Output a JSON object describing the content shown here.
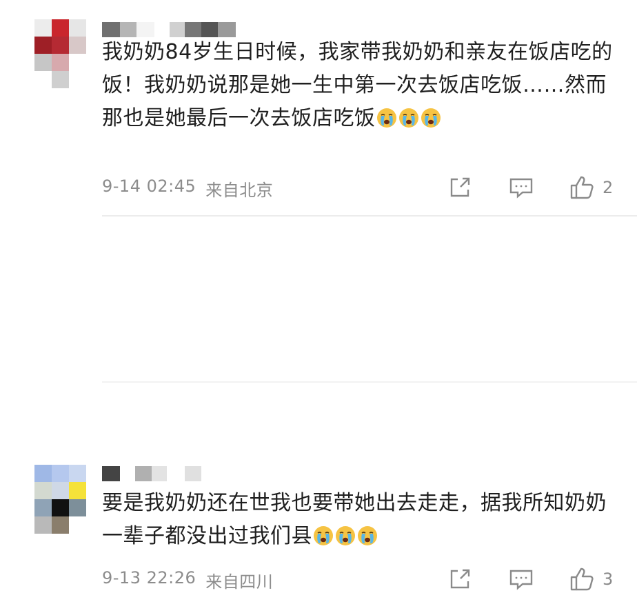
{
  "comments": [
    {
      "text_before_emoji": "我奶奶84岁生日时候，我家带我奶奶和亲友在饭店吃的饭！我奶奶说那是她一生中第一次去饭店吃饭……然而那也是她最后一次去饭店吃饭",
      "emoji_count": 3,
      "emoji_name": "crying-face-icon",
      "time": "9-14 02:45",
      "location": "来自北京",
      "likes": "2"
    },
    {
      "text_before_emoji": "要是我奶奶还在世我也要带她出去走走，据我所知奶奶一辈子都没出过我们县",
      "emoji_count": 3,
      "emoji_name": "crying-face-icon",
      "time": "9-13 22:26",
      "location": "来自四川",
      "likes": "3"
    }
  ],
  "icons": {
    "share": "share-icon",
    "reply": "reply-icon",
    "like": "thumbs-up-icon"
  },
  "colors": {
    "meta_text": "#8c8c8c",
    "icon": "#8a8a8a",
    "emoji_face": "#f6c343",
    "emoji_tear": "#58b6e8"
  }
}
